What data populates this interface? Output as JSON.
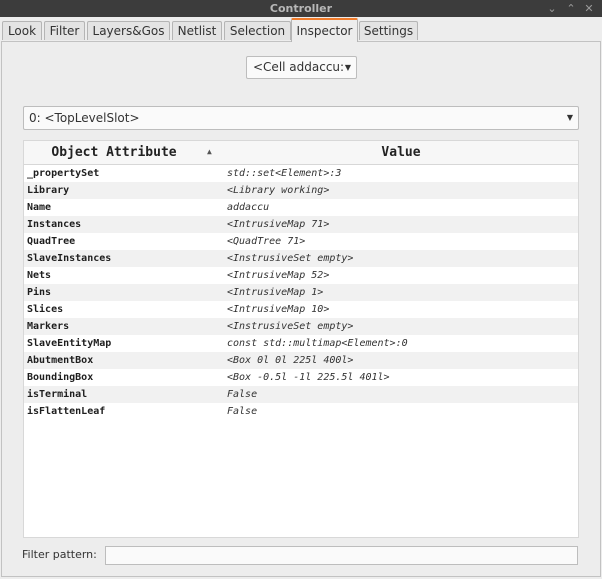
{
  "window": {
    "title": "Controller",
    "controls": [
      "⌄",
      "⌃",
      "✕"
    ]
  },
  "tabs": [
    "Look",
    "Filter",
    "Layers&Gos",
    "Netlist",
    "Selection",
    "Inspector",
    "Settings"
  ],
  "active_tab": "Inspector",
  "cell_combo": {
    "value": "<Cell addaccu:"
  },
  "slot_combo": {
    "value": "0: <TopLevelSlot>"
  },
  "table": {
    "columns": [
      "Object Attribute",
      "Value"
    ],
    "sort_column": "Object Attribute",
    "sort_order": "ascending",
    "rows": [
      {
        "attr": "_propertySet",
        "value": "std::set<Element>:3"
      },
      {
        "attr": "Library",
        "value": "<Library working>"
      },
      {
        "attr": "Name",
        "value": "addaccu"
      },
      {
        "attr": "Instances",
        "value": "<IntrusiveMap 71>"
      },
      {
        "attr": "QuadTree",
        "value": "<QuadTree 71>"
      },
      {
        "attr": "SlaveInstances",
        "value": "<InstrusiveSet empty>"
      },
      {
        "attr": "Nets",
        "value": "<IntrusiveMap 52>"
      },
      {
        "attr": "Pins",
        "value": "<IntrusiveMap 1>"
      },
      {
        "attr": "Slices",
        "value": "<IntrusiveMap 10>"
      },
      {
        "attr": "Markers",
        "value": "<InstrusiveSet empty>"
      },
      {
        "attr": "SlaveEntityMap",
        "value": "const std::multimap<Element>:0"
      },
      {
        "attr": "AbutmentBox",
        "value": "<Box 0l 0l 225l 400l>"
      },
      {
        "attr": "BoundingBox",
        "value": "<Box -0.5l -1l 225.5l 401l>"
      },
      {
        "attr": "isTerminal",
        "value": "False"
      },
      {
        "attr": "isFlattenLeaf",
        "value": "False"
      }
    ]
  },
  "filter": {
    "label": "Filter pattern:",
    "value": ""
  },
  "colors": {
    "accent": "#f07c2c",
    "titlebar": "#3c3c3c"
  }
}
